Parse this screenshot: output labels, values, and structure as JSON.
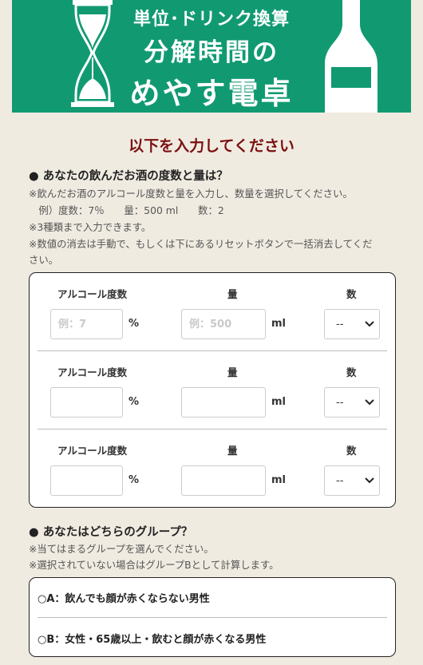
{
  "header": {
    "title_line1": "単位･ドリンク換算",
    "title_line2": "分解時間の",
    "title_line3": "めやす電卓",
    "bg_color": "#119a72"
  },
  "main": {
    "heading": "以下を入力してください",
    "q1": {
      "title": "● あなたの飲んだお酒の度数と量は？",
      "notes": [
        "※飲んだお酒のアルコール度数と量を入力し、数量を選択してください。",
        "　例）度数：7％　　量：500 ml　　数：2",
        "※3種類まで入力できます。",
        "※数値の消去は手動で、もしくは下にあるリセットボタンで一括消去してくだ",
        "さい。"
      ]
    },
    "drinks": [
      {
        "abv_label": "アルコール度数",
        "amount_label": "量",
        "count_label": "数",
        "abv_value": "",
        "abv_placeholder": "例：7",
        "abv_unit": "%",
        "amount_value": "",
        "amount_placeholder": "例：500",
        "amount_unit": "ml",
        "count_value": "--"
      },
      {
        "abv_label": "アルコール度数",
        "amount_label": "量",
        "count_label": "数",
        "abv_value": "",
        "abv_placeholder": "",
        "abv_unit": "%",
        "amount_value": "",
        "amount_placeholder": "",
        "amount_unit": "ml",
        "count_value": "--"
      },
      {
        "abv_label": "アルコール度数",
        "amount_label": "量",
        "count_label": "数",
        "abv_value": "",
        "abv_placeholder": "",
        "abv_unit": "%",
        "amount_value": "",
        "amount_placeholder": "",
        "amount_unit": "ml",
        "count_value": "--"
      }
    ],
    "q2": {
      "title": "● あなたはどちらのグループ？",
      "notes": [
        "※当てはまるグループを選んでください。",
        "※選択されていない場合はグループBとして計算します。"
      ],
      "options": [
        "A：飲んでも顔が赤くならない男性",
        "B：女性・65歳以上・飲むと顔が赤くなる男性"
      ]
    }
  }
}
